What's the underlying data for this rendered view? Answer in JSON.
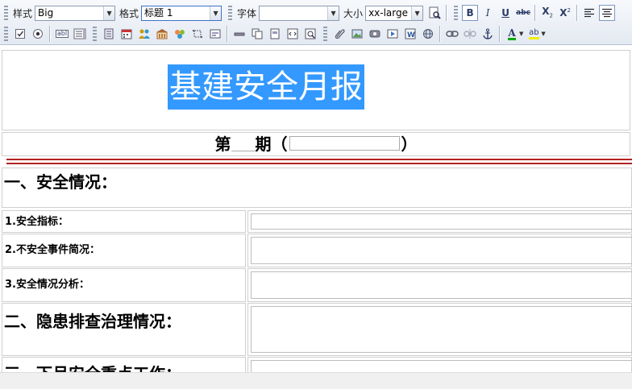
{
  "toolbar": {
    "style_label": "样式",
    "style_value": "Big",
    "format_label": "格式",
    "format_value": "标题 1",
    "font_label": "字体",
    "font_value": "",
    "size_label": "大小",
    "size_value": "xx-large",
    "bold_label": "B",
    "italic_label": "I",
    "underline_label": "U",
    "strike_label": "abc",
    "sub_label": "X",
    "sub_script": "2",
    "sup_label": "X",
    "sup_script": "2",
    "textbox_label": "abl",
    "fontcolor_label": "A",
    "highlight_label": "ab"
  },
  "document": {
    "title": "基建安全月报",
    "issue_prefix": "第",
    "issue_mid": "期（",
    "issue_suffix": "）",
    "section1": "一、安全情况：",
    "item1": "1.安全指标：",
    "item2": "2.不安全事件简况：",
    "item3": "3.安全情况分析：",
    "section2": "二、隐患排查治理情况：",
    "section3": "三、下月安全重点工作："
  },
  "colors": {
    "selection": "#3399ff",
    "divider": "#b22222",
    "toolbar_bg": "#e3e9f2"
  }
}
